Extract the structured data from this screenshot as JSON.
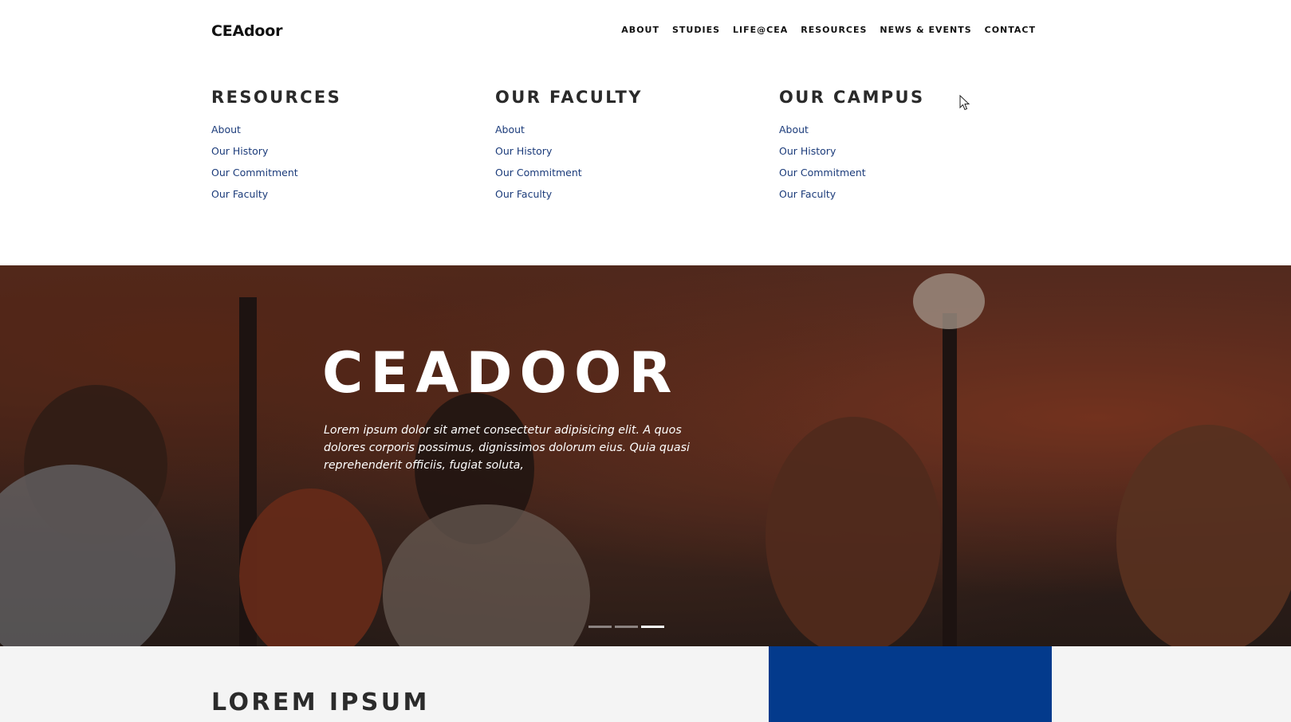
{
  "header": {
    "logo": "CEAdoor",
    "nav": [
      {
        "label": "ABOUT"
      },
      {
        "label": "STUDIES"
      },
      {
        "label": "LIFE@CEA"
      },
      {
        "label": "RESOURCES"
      },
      {
        "label": "NEWS & EVENTS"
      },
      {
        "label": "CONTACT"
      }
    ]
  },
  "mega_menu": {
    "columns": [
      {
        "title": "RESOURCES",
        "links": [
          "About",
          "Our History",
          "Our Commitment",
          "Our Faculty"
        ]
      },
      {
        "title": "OUR FACULTY",
        "links": [
          "About",
          "Our History",
          "Our Commitment",
          "Our Faculty"
        ]
      },
      {
        "title": "OUR CAMPUS",
        "links": [
          "About",
          "Our History",
          "Our Commitment",
          "Our Faculty"
        ]
      }
    ]
  },
  "hero": {
    "title": "CEADOOR",
    "text": "Lorem ipsum dolor sit amet consectetur adipisicing elit. A quos dolores corporis possimus, dignissimos dolorum eius. Quia quasi reprehenderit officiis, fugiat soluta,",
    "slides_total": 3,
    "active_slide": 3
  },
  "section": {
    "heading": "LOREM IPSUM"
  },
  "colors": {
    "link": "#1b3b7a",
    "panel_blue": "#033a8c",
    "section_bg": "#f4f4f4"
  }
}
